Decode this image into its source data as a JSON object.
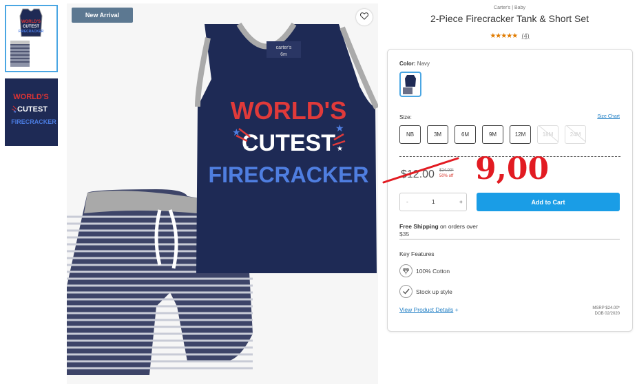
{
  "gallery": {
    "badge": "New Arrival",
    "shirt_text": [
      "WORLD'S",
      "CUTEST",
      "FIRECRACKER"
    ],
    "tag_brand": "carter's",
    "tag_size": "6m"
  },
  "product": {
    "brand_line": "Carter's | Baby",
    "title": "2-Piece Firecracker Tank & Short Set",
    "stars": "★★★★★",
    "review_count": "(4)"
  },
  "options": {
    "color_label": "Color:",
    "color_value": "Navy",
    "size_label": "Size:",
    "size_chart": "Size Chart",
    "sizes": [
      {
        "label": "NB",
        "available": true
      },
      {
        "label": "3M",
        "available": true
      },
      {
        "label": "6M",
        "available": true
      },
      {
        "label": "9M",
        "available": true
      },
      {
        "label": "12M",
        "available": true
      },
      {
        "label": "18M",
        "available": false
      },
      {
        "label": "24M",
        "available": false
      }
    ]
  },
  "pricing": {
    "sale_price": "$12.00",
    "original_price": "$24.00*",
    "discount": "50% off",
    "handwritten_price": "9,00"
  },
  "cart": {
    "minus": "-",
    "quantity": "1",
    "plus": "+",
    "add_label": "Add to Cart"
  },
  "shipping": {
    "bold": "Free Shipping",
    "rest": "on orders over",
    "amount": "$35"
  },
  "features": {
    "title": "Key Features",
    "items": [
      "100% Cotton",
      "Stock up style"
    ],
    "details_link": "View Product Details",
    "details_plus": "+",
    "msrp": "MSRP $24.00*",
    "dob": "DOB 02/2020"
  },
  "colors": {
    "navy": "#1e2a55",
    "accent_blue": "#1a9de6",
    "sale_red": "#e21b22",
    "star_orange": "#e07b00"
  }
}
